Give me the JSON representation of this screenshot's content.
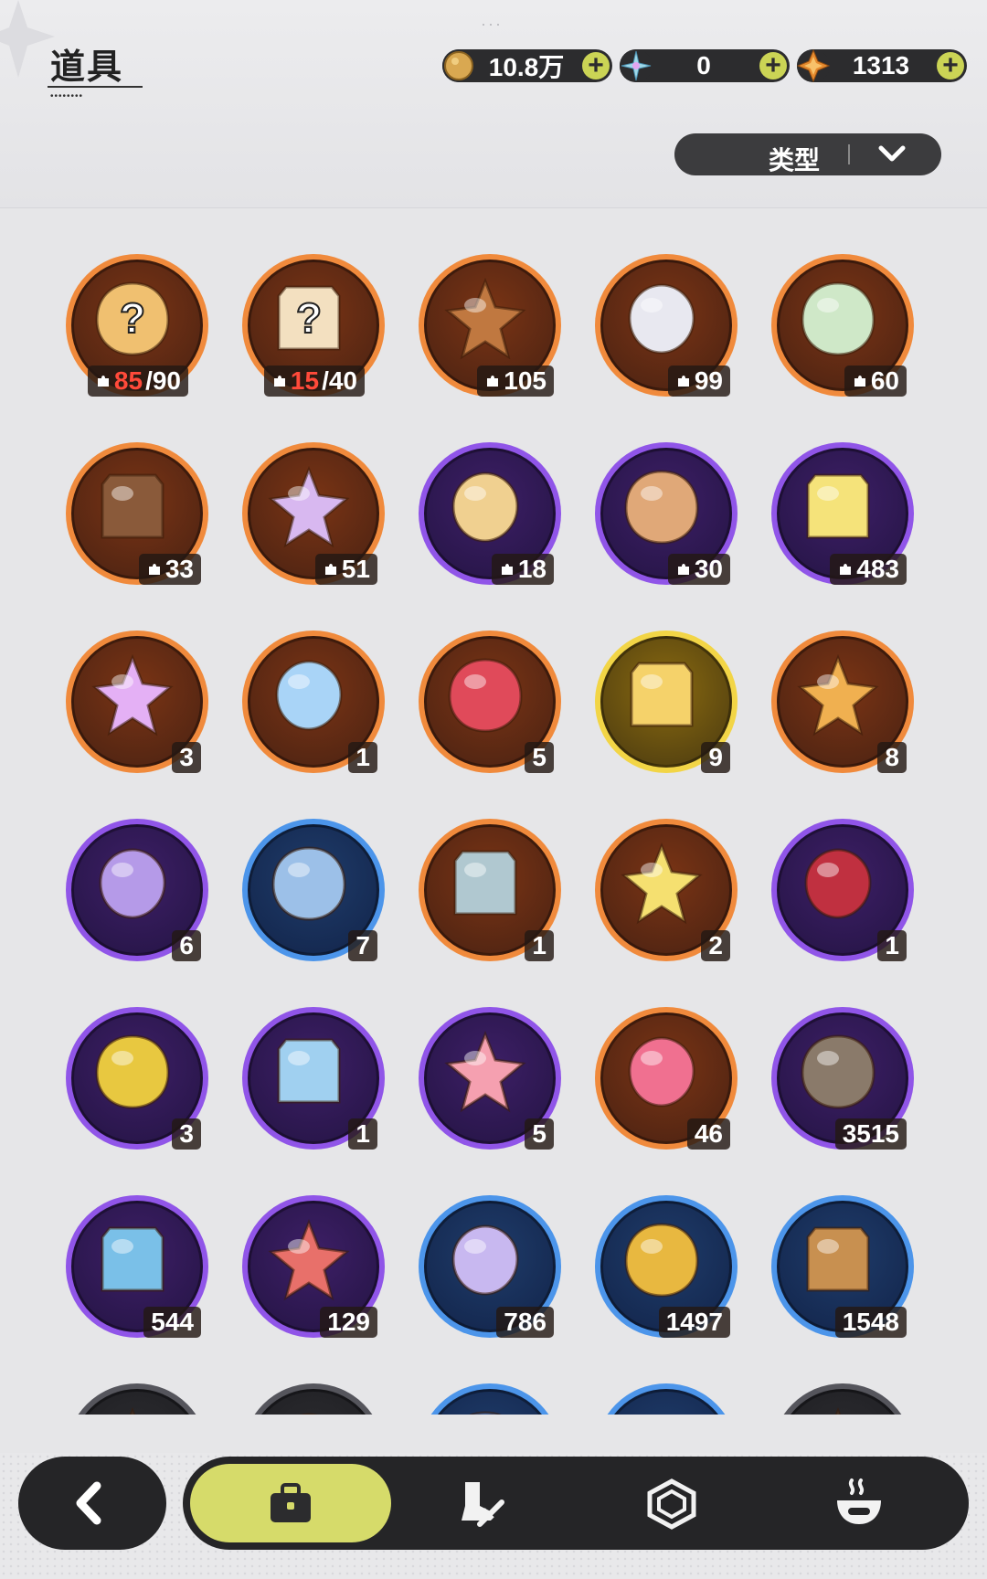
{
  "header": {
    "title": "道具",
    "currencies": [
      {
        "icon": "gold-coin-icon",
        "value": "10.8万",
        "color": "#d9a851"
      },
      {
        "icon": "crystal-snowflake-icon",
        "value": "0",
        "color": "#9fd8e8"
      },
      {
        "icon": "orange-star-gem-icon",
        "value": "1313",
        "color": "#e58a2e"
      }
    ],
    "sort": {
      "label": "类型"
    }
  },
  "items": [
    {
      "icon": "mystery-orange-pet-icon",
      "rarity": "orange",
      "count_owned": "85",
      "count_total": "/90"
    },
    {
      "icon": "mystery-yellow-pet-icon",
      "rarity": "orange",
      "count_owned": "15",
      "count_total": "/40"
    },
    {
      "icon": "bear-pet-fragment-icon",
      "rarity": "orange",
      "count": "105",
      "puzzle": true
    },
    {
      "icon": "knight-robot-pet-fragment-icon",
      "rarity": "orange",
      "count": "99",
      "puzzle": true
    },
    {
      "icon": "white-cat-pet-fragment-icon",
      "rarity": "orange",
      "count": "60",
      "puzzle": true
    },
    {
      "icon": "dark-bear-pet-fragment-icon",
      "rarity": "orange",
      "count": "33",
      "puzzle": true
    },
    {
      "icon": "purple-cat-pet-fragment-icon",
      "rarity": "orange",
      "count": "51",
      "puzzle": true
    },
    {
      "icon": "hamster-pet-fragment-icon",
      "rarity": "purple",
      "count": "18",
      "puzzle": true
    },
    {
      "icon": "bear-cub-pet-fragment-icon",
      "rarity": "purple",
      "count": "30",
      "puzzle": true
    },
    {
      "icon": "yellow-bird-pet-fragment-icon",
      "rarity": "purple",
      "count": "483",
      "puzzle": true
    },
    {
      "icon": "pink-star-crystal-icon",
      "rarity": "orange",
      "count": "3"
    },
    {
      "icon": "blue-star-crystal-icon",
      "rarity": "orange",
      "count": "1"
    },
    {
      "icon": "paw-pendant-icon",
      "rarity": "orange",
      "count": "5"
    },
    {
      "icon": "gold-character-card-icon",
      "rarity": "gold",
      "count": "9"
    },
    {
      "icon": "orange-character-card-icon",
      "rarity": "orange",
      "count": "8"
    },
    {
      "icon": "purple-character-card-icon",
      "rarity": "purple",
      "count": "6"
    },
    {
      "icon": "blue-character-card-icon",
      "rarity": "blue",
      "count": "7"
    },
    {
      "icon": "silver-swap-card-icon",
      "rarity": "orange",
      "count": "1"
    },
    {
      "icon": "clover-ticket-icon",
      "rarity": "orange",
      "count": "2"
    },
    {
      "icon": "gift-box-icon",
      "rarity": "purple",
      "count": "1"
    },
    {
      "icon": "golden-shell-icon",
      "rarity": "purple",
      "count": "3"
    },
    {
      "icon": "magic-mirror-icon",
      "rarity": "purple",
      "count": "1"
    },
    {
      "icon": "pink-apple-icon",
      "rarity": "purple",
      "count": "5"
    },
    {
      "icon": "crystal-heart-icon",
      "rarity": "orange",
      "count": "46"
    },
    {
      "icon": "fist-medal-icon",
      "rarity": "purple",
      "count": "3515"
    },
    {
      "icon": "blue-rune-coin-icon",
      "rarity": "purple",
      "count": "544"
    },
    {
      "icon": "heart-coin-icon",
      "rarity": "purple",
      "count": "129"
    },
    {
      "icon": "scale-pendant-icon",
      "rarity": "blue",
      "count": "786"
    },
    {
      "icon": "gold-gear-icon",
      "rarity": "blue",
      "count": "1497"
    },
    {
      "icon": "bronze-leaf-icon",
      "rarity": "blue",
      "count": "1548"
    },
    {
      "icon": "dark-item-icon",
      "rarity": "dark",
      "count": ""
    },
    {
      "icon": "dark-item-icon",
      "rarity": "dark",
      "count": ""
    },
    {
      "icon": "blue-item-icon",
      "rarity": "blue",
      "count": ""
    },
    {
      "icon": "red-gem-item-icon",
      "rarity": "blue",
      "count": ""
    },
    {
      "icon": "dark-item-icon",
      "rarity": "dark",
      "count": ""
    }
  ],
  "colors": {
    "orange": "#e0722c",
    "purple": "#7a3fd0",
    "gold": "#e6c83a",
    "blue": "#3a7fd6",
    "dark": "#333338",
    "accent": "#d6db6a"
  },
  "bottom_nav": {
    "tabs": [
      {
        "name": "bag-tab",
        "icon": "briefcase-icon",
        "active": true
      },
      {
        "name": "equipment-tab",
        "icon": "boot-sword-icon",
        "active": false
      },
      {
        "name": "gem-tab",
        "icon": "hexagon-gem-icon",
        "active": false
      },
      {
        "name": "cooking-tab",
        "icon": "cooking-pot-icon",
        "active": false
      }
    ]
  }
}
